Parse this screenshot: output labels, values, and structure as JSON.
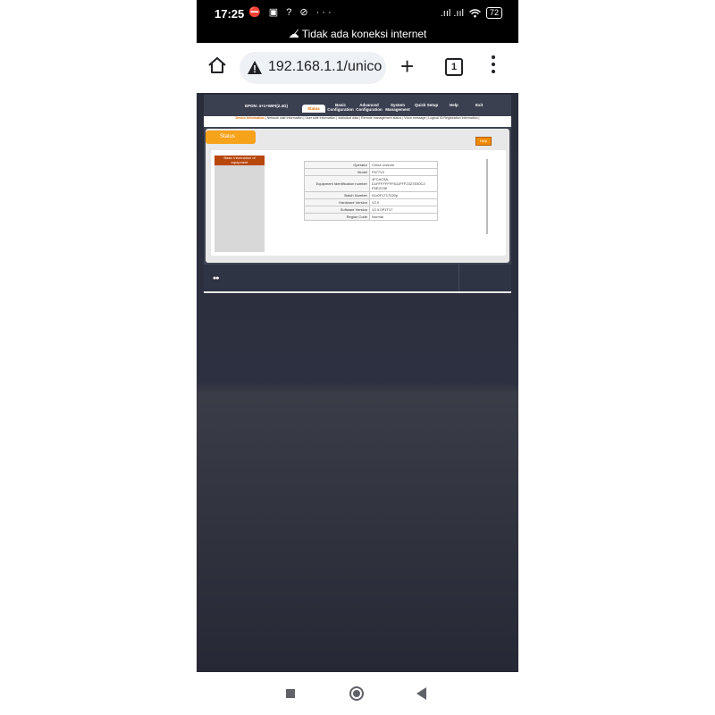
{
  "statusbar": {
    "time": "17:25",
    "left_icons": "⛔ ▣ ? ⊘ ···",
    "signal": ".ııl .ııl",
    "wifi": "wifi-icon",
    "battery": "72"
  },
  "network_notice": "Tidak ada koneksi internet",
  "browser": {
    "url": "192.168.1.1/unico",
    "tab_count": "1"
  },
  "router": {
    "device_name": "EPON: 4+1+WIFI(2.4G)",
    "nav": [
      {
        "label": "Status",
        "active": true
      },
      {
        "label": "Basic Configuration"
      },
      {
        "label": "Advanced Configuration"
      },
      {
        "label": "System Management"
      },
      {
        "label": "Quick Setup"
      },
      {
        "label": "Help"
      },
      {
        "label": "Exit"
      }
    ],
    "subnav": {
      "active": "Device Information",
      "rest": " | Network side Information | User side information | statistical data | Remote management status | Voice message | Logical ID Registration Information |"
    },
    "tab_label": "Status",
    "help_label": "Help",
    "side_heading": "Basic Information of equipment",
    "info_rows": [
      {
        "label": "Operator",
        "value": "China Unicom"
      },
      {
        "label": "Model",
        "value": "F677V2"
      },
      {
        "label": "Equipment Identification number",
        "value": "4FCAC5A-D1FFFFFFFF611FFF23Z7E50C2 F6E2C98"
      },
      {
        "label": "Batch Number",
        "value": "01c0F1T17020p"
      },
      {
        "label": "Hardware Version",
        "value": "V2.0"
      },
      {
        "label": "Software Version",
        "value": "V2.0.0P1T17"
      },
      {
        "label": "Region Code",
        "value": "Normal"
      }
    ],
    "footer_dots": "●●"
  }
}
